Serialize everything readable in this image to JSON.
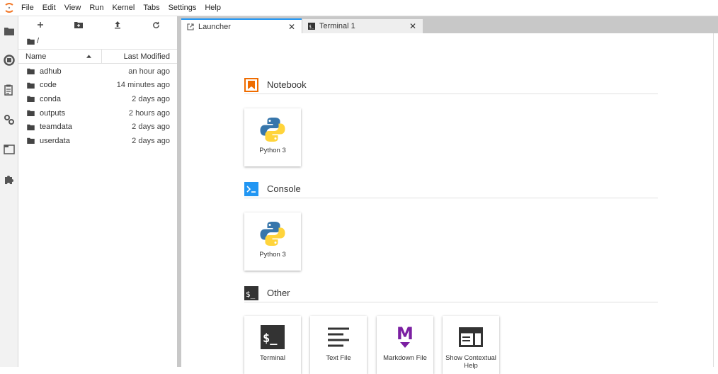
{
  "menubar": {
    "logo": "jupyter-logo",
    "items": [
      "File",
      "Edit",
      "View",
      "Run",
      "Kernel",
      "Tabs",
      "Settings",
      "Help"
    ]
  },
  "leftbar": {
    "icons": [
      "folder-icon",
      "running-icon",
      "commands-icon",
      "property-inspector-icon",
      "tabs-icon",
      "extension-icon"
    ]
  },
  "filebrowser": {
    "toolbar": [
      "new-launcher-icon",
      "new-folder-icon",
      "upload-icon",
      "refresh-icon"
    ],
    "path": "/",
    "columns": {
      "name": "Name",
      "modified": "Last Modified"
    },
    "items": [
      {
        "name": "adhub",
        "modified": "an hour ago"
      },
      {
        "name": "code",
        "modified": "14 minutes ago"
      },
      {
        "name": "conda",
        "modified": "2 days ago"
      },
      {
        "name": "outputs",
        "modified": "2 hours ago"
      },
      {
        "name": "teamdata",
        "modified": "2 days ago"
      },
      {
        "name": "userdata",
        "modified": "2 days ago"
      }
    ]
  },
  "tabs": [
    {
      "label": "Launcher",
      "icon": "launcher-icon",
      "active": true
    },
    {
      "label": "Terminal 1",
      "icon": "terminal-icon",
      "active": false
    }
  ],
  "launcher": {
    "sections": [
      {
        "title": "Notebook",
        "icon": "notebook-icon",
        "cards": [
          {
            "label": "Python 3",
            "icon": "python-icon"
          }
        ]
      },
      {
        "title": "Console",
        "icon": "console-icon",
        "cards": [
          {
            "label": "Python 3",
            "icon": "python-icon"
          }
        ]
      },
      {
        "title": "Other",
        "icon": "other-icon",
        "cards": [
          {
            "label": "Terminal",
            "icon": "terminal-icon"
          },
          {
            "label": "Text File",
            "icon": "text-file-icon"
          },
          {
            "label": "Markdown File",
            "icon": "markdown-icon"
          },
          {
            "label": "Show Contextual Help",
            "icon": "contextual-help-icon"
          }
        ]
      }
    ]
  },
  "colors": {
    "accent": "#2196f3",
    "notebook": "#ef6c00",
    "console": "#2196f3",
    "markdown": "#7b1fa2"
  }
}
